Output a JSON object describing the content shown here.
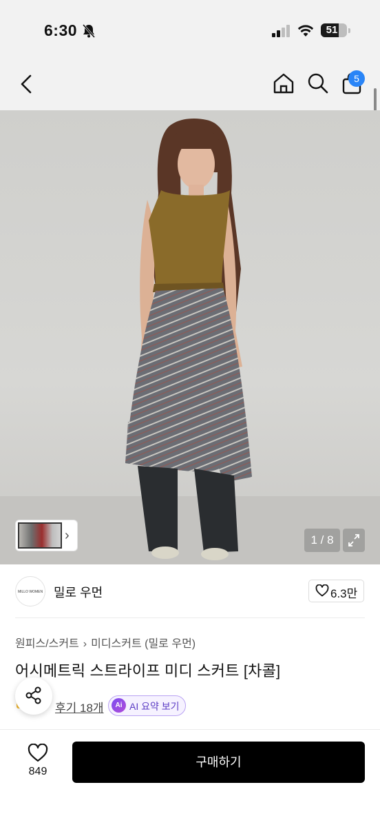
{
  "status_bar": {
    "time": "6:30",
    "battery": "51"
  },
  "nav": {
    "cart_count": "5"
  },
  "gallery": {
    "page_counter": "1 / 8"
  },
  "brand": {
    "logo_text": "MILLO WOMEN",
    "name": "밀로 우먼",
    "likes": "6.3만"
  },
  "breadcrumb": {
    "items": [
      "원피스/스커트",
      "미디스커트 (밀로 우먼)"
    ],
    "separator": "›"
  },
  "product": {
    "title": "어시메트릭 스트라이프 미디 스커트 [차콜]"
  },
  "reviews": {
    "label": "후기 18개"
  },
  "ai_summary": {
    "badge": "Ai",
    "label": "AI 요약 보기"
  },
  "bottom_bar": {
    "wish_count": "849",
    "buy_label": "구매하기"
  },
  "colors": {
    "accent_blue": "#2a85f7",
    "ai_purple": "#7b4cf0",
    "buy_button": "#000000"
  },
  "icons": [
    "bell-off-icon",
    "signal-icon",
    "wifi-icon",
    "battery-icon",
    "back-arrow-icon",
    "home-icon",
    "search-icon",
    "cart-icon",
    "expand-icon",
    "heart-icon",
    "share-icon",
    "chevron-right-icon"
  ]
}
